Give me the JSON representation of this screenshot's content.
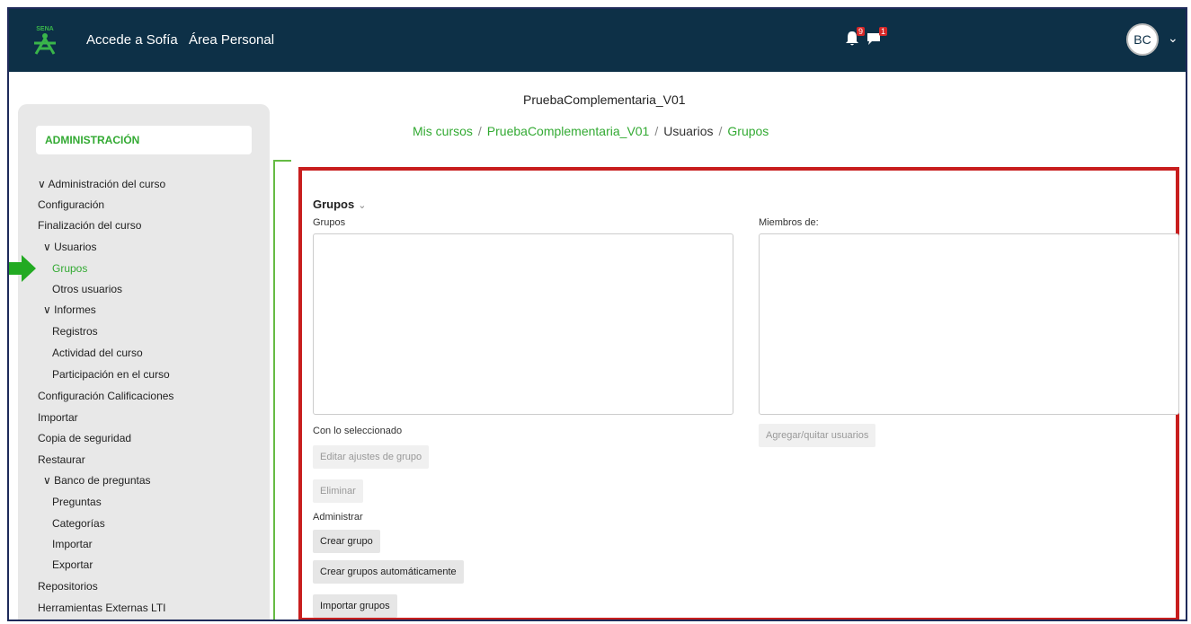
{
  "topbar": {
    "nav_links": [
      "Accede a Sofía",
      "Área Personal"
    ],
    "notifications_count": "9",
    "messages_count": "1",
    "user_initials": "BC",
    "logo_text": "SENA"
  },
  "header": {
    "course_title": "PruebaComplementaria_V01",
    "breadcrumb": [
      "Mis cursos",
      "PruebaComplementaria_V01",
      "Usuarios",
      "Grupos"
    ]
  },
  "sidebar": {
    "title": "ADMINISTRACIÓN",
    "items": [
      {
        "label": "∨ Administración del curso"
      },
      {
        "label": "Configuración"
      },
      {
        "label": "Finalización del curso"
      },
      {
        "label": "∨ Usuarios"
      },
      {
        "label": "Grupos"
      },
      {
        "label": "Otros usuarios"
      },
      {
        "label": "∨ Informes"
      },
      {
        "label": "Registros"
      },
      {
        "label": "Actividad del curso"
      },
      {
        "label": "Participación en el curso"
      },
      {
        "label": "Configuración Calificaciones"
      },
      {
        "label": "Importar"
      },
      {
        "label": "Copia de seguridad"
      },
      {
        "label": "Restaurar"
      },
      {
        "label": "∨ Banco de preguntas"
      },
      {
        "label": "Preguntas"
      },
      {
        "label": "Categorías"
      },
      {
        "label": "Importar"
      },
      {
        "label": "Exportar"
      },
      {
        "label": "Repositorios"
      },
      {
        "label": "Herramientas Externas LTI"
      }
    ]
  },
  "main": {
    "heading": "Grupos",
    "groups_label": "Grupos",
    "members_label": "Miembros de:",
    "with_selected_label": "Con lo seleccionado",
    "edit_button": "Editar ajustes de grupo",
    "delete_button": "Eliminar",
    "add_remove_button": "Agregar/quitar usuarios",
    "manage_label": "Administrar",
    "create_button": "Crear grupo",
    "auto_create_button": "Crear grupos automáticamente",
    "import_button": "Importar grupos"
  },
  "colors": {
    "topbar": "#0d3047",
    "accent_green": "#33aa33",
    "highlight_red": "#c81e1e"
  }
}
